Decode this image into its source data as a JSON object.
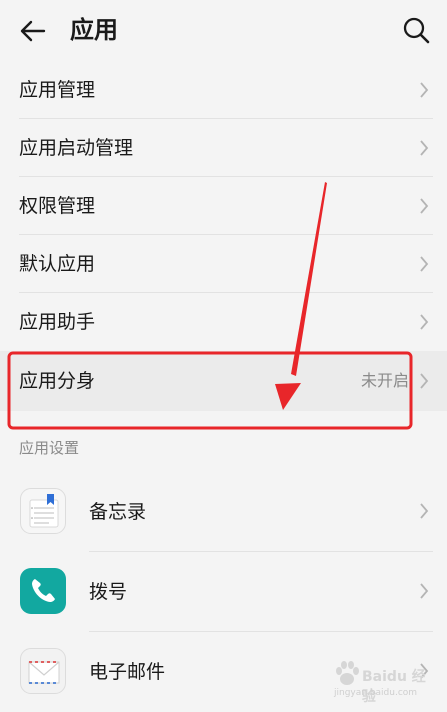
{
  "header": {
    "title": "应用"
  },
  "menu": [
    {
      "label": "应用管理"
    },
    {
      "label": "应用启动管理"
    },
    {
      "label": "权限管理"
    },
    {
      "label": "默认应用"
    },
    {
      "label": "应用助手"
    },
    {
      "label": "应用分身",
      "value": "未开启"
    }
  ],
  "section": {
    "label": "应用设置"
  },
  "apps": [
    {
      "label": "备忘录",
      "icon": "memo-icon"
    },
    {
      "label": "拨号",
      "icon": "phone-icon"
    },
    {
      "label": "电子邮件",
      "icon": "mail-icon"
    }
  ],
  "watermark": {
    "text": "Baidu 经验",
    "url": "jingyan.baidu.com"
  },
  "colors": {
    "highlight": "#e8262a",
    "dial_icon_bg": "#12a8a0",
    "memo_bookmark": "#2f6fd6"
  }
}
